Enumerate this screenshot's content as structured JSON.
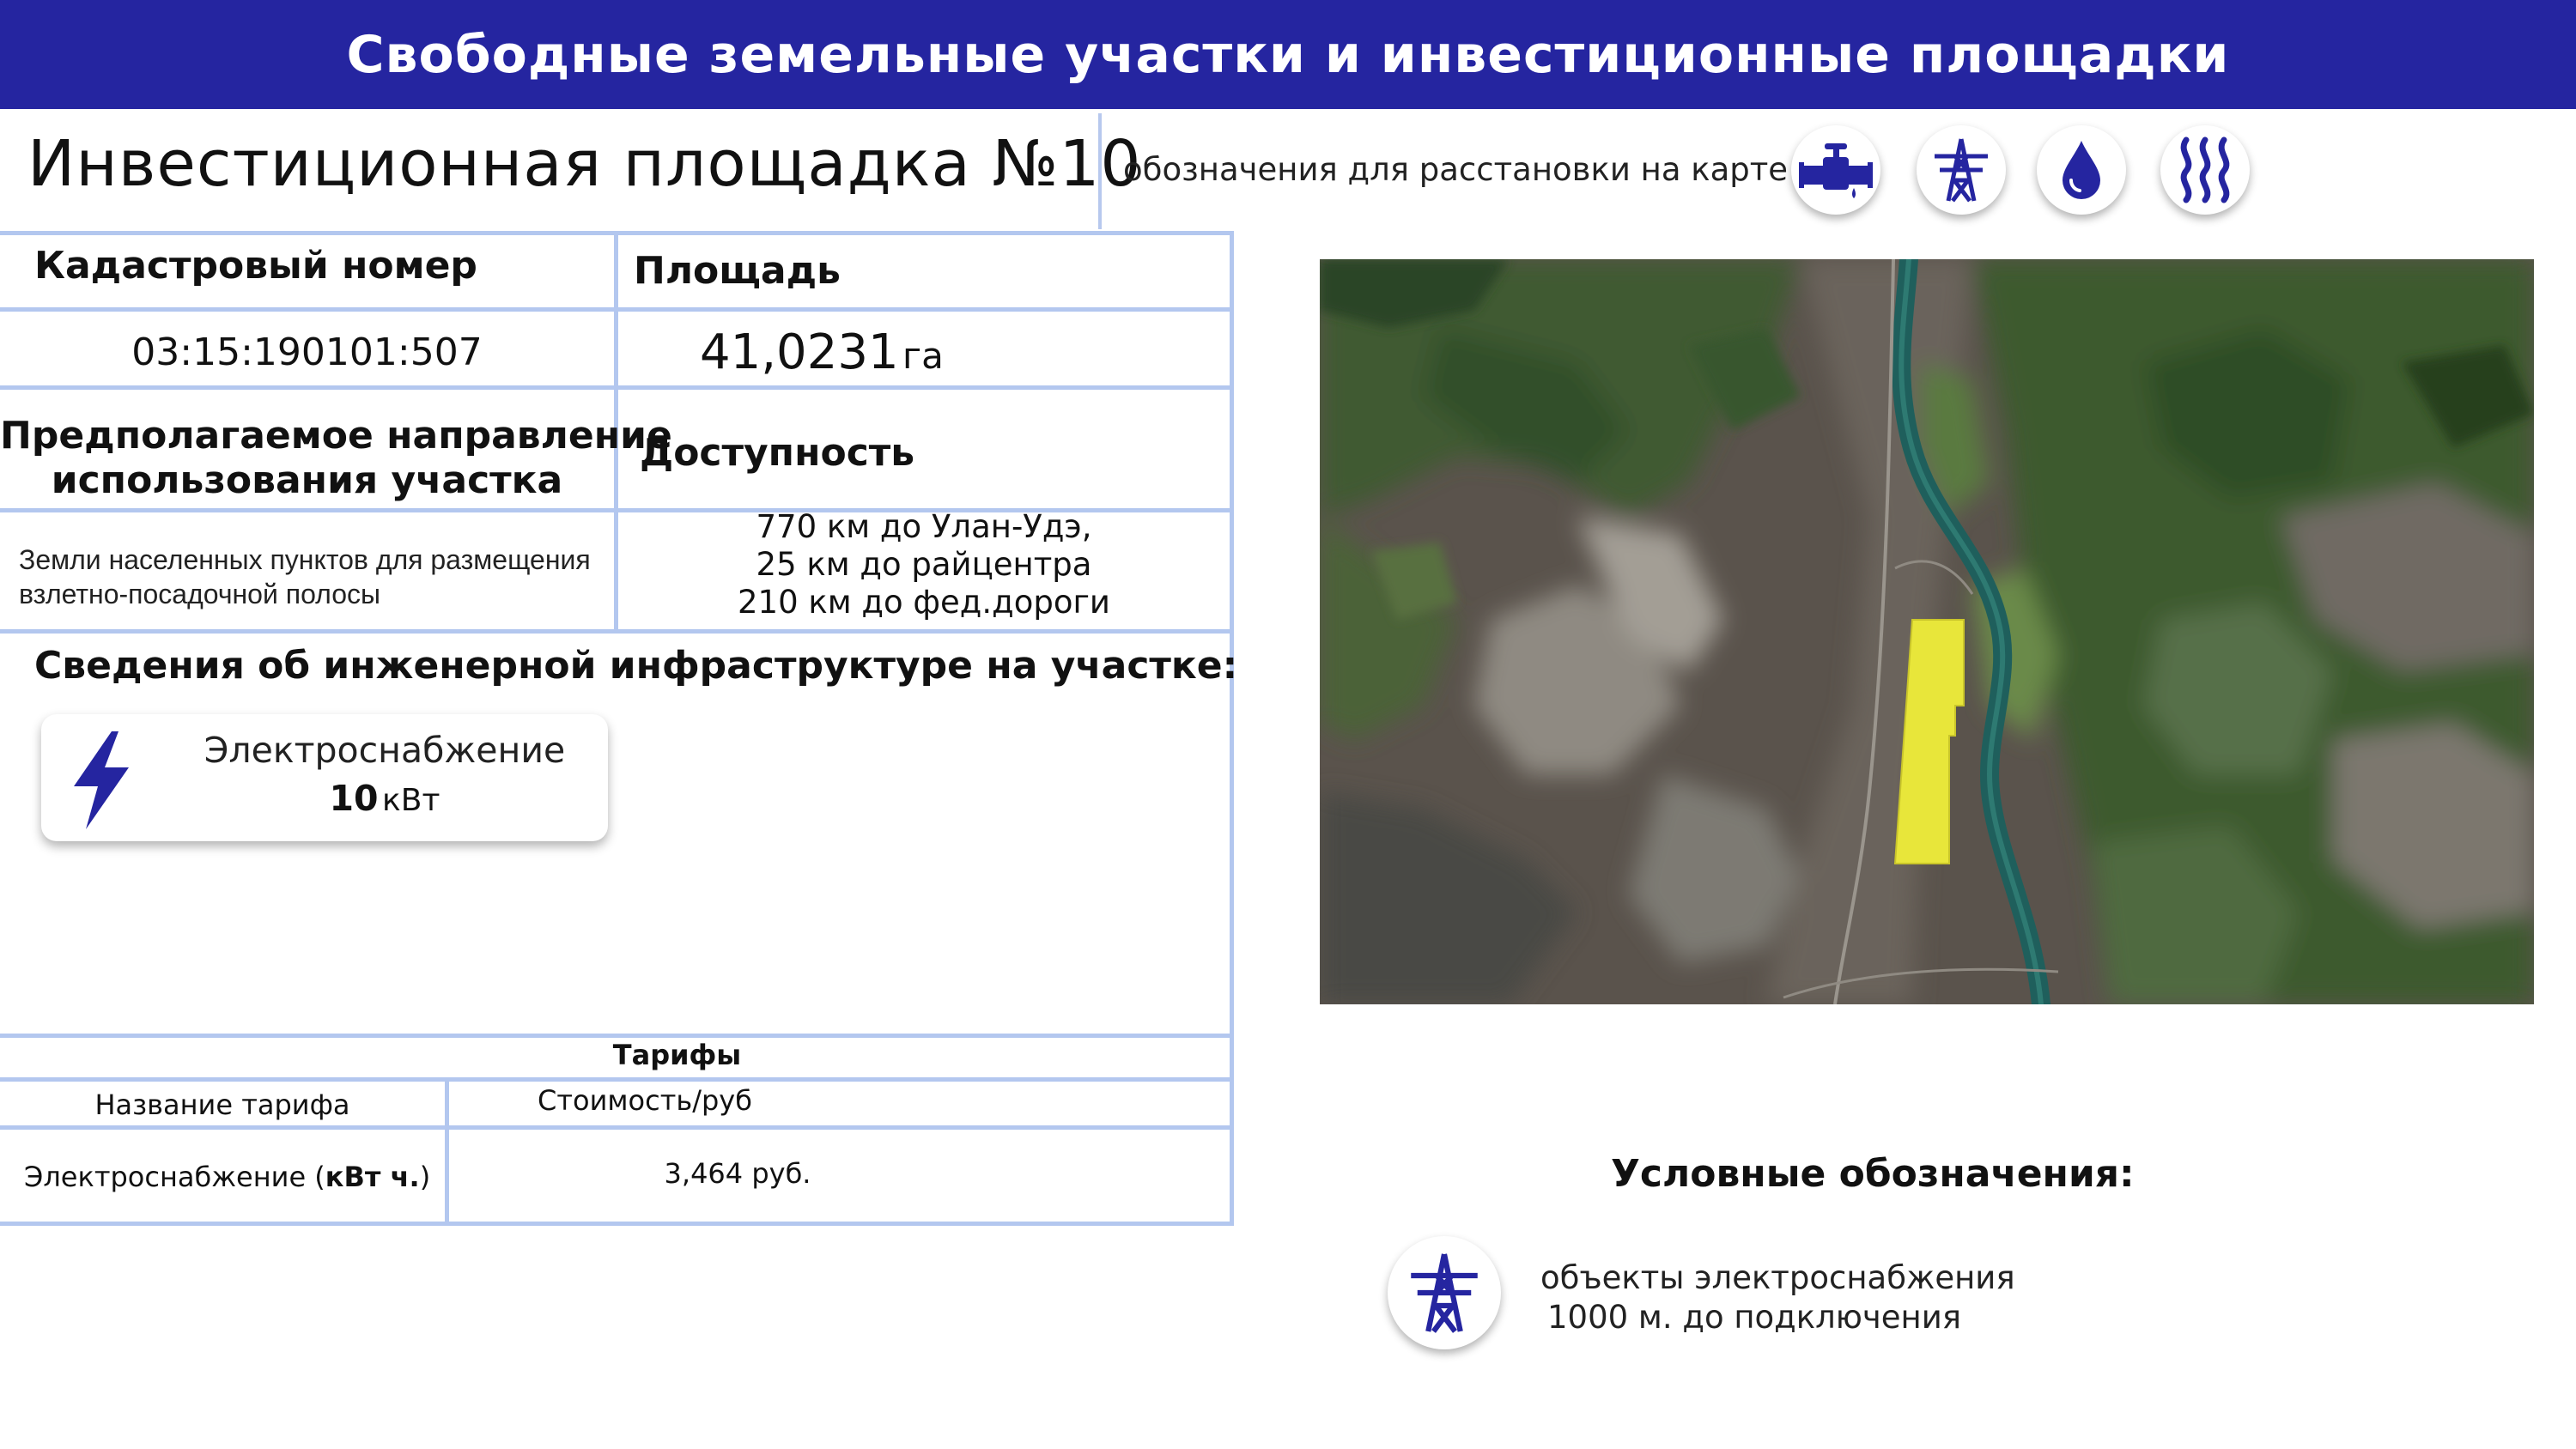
{
  "header": {
    "title": "Свободные земельные участки и инвестиционные площадки"
  },
  "site": {
    "title": "Инвестиционная площадка  №10"
  },
  "map_legend_hint": "обозначения для расстановки на карте",
  "legend_icons": [
    "water-pipe-icon",
    "power-tower-icon",
    "water-drop-icon",
    "heat-waves-icon"
  ],
  "colors": {
    "header_bg": "#2525a0",
    "accent": "#2525a0",
    "table_lines": "#b3c7ef",
    "plot_highlight": "#e8e63a",
    "river": "#1f5f5c"
  },
  "table": {
    "cadastral_label": "Кадастровый номер",
    "cadastral_value": "03:15:190101:507",
    "area_label": "Площадь",
    "area_value": "41,0231",
    "area_unit": "га",
    "usage_label_line1": "Предполагаемое направление",
    "usage_label_line2": "использования участка",
    "usage_value_line1": "Земли населенных пунктов для размещения",
    "usage_value_line2": "взлетно-посадочной полосы",
    "access_label": "Доступность",
    "access_lines": [
      "770 км до Улан-Удэ,",
      "25 км до райцентра",
      "210 км до фед.дороги"
    ]
  },
  "infrastructure": {
    "title": "Сведения об инженерной инфраструктуре на участке:",
    "power_label": "Электроснабжение",
    "power_value": "10",
    "power_unit": "кВт"
  },
  "tariffs": {
    "title": "Тарифы",
    "col_name": "Название тарифа",
    "col_cost": "Стоимость/руб",
    "row_name_prefix": "Электроснабжение (",
    "row_name_unit": "кВт ч.",
    "row_name_suffix": ")",
    "row_cost": "3,464 руб."
  },
  "legend": {
    "title": "Условные обозначения:",
    "item_line1": "объекты электроснабжения",
    "item_line2": "1000 м. до подключения"
  }
}
